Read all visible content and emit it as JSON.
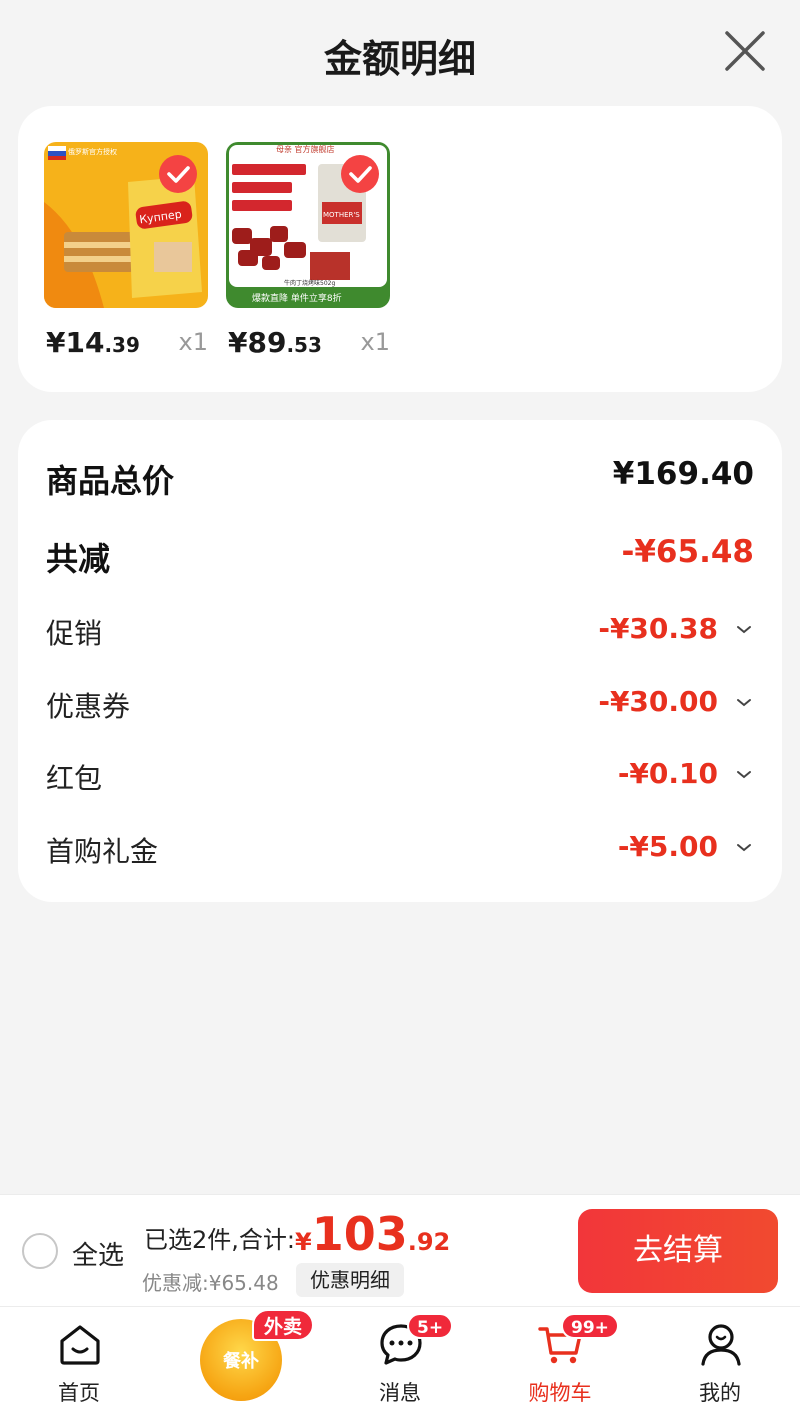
{
  "header": {
    "title": "金额明细",
    "close_icon": "close-icon"
  },
  "products": [
    {
      "price_int": "¥14",
      "price_dec": ".39",
      "qty": "x1",
      "thumb_text": "Куппер",
      "flag_text": "俄罗斯官方授权"
    },
    {
      "price_int": "¥89",
      "price_dec": ".53",
      "qty": "x1",
      "thumb_text": "MOTHER'S",
      "store_text": "母亲 官方旗舰店",
      "bullets": [
        "颗颗真牛肉 肉质紧实",
        "轻烘慢烤 非油炸",
        "软硬适中 老少皆宜"
      ],
      "size_text": "牛肉丁烧烤味502g",
      "banner_text": "爆款直降 单件立享8折"
    }
  ],
  "summary": {
    "total_label": "商品总价",
    "total_value": "¥169.40",
    "reduce_label": "共减",
    "reduce_value": "-¥65.48",
    "items": [
      {
        "label": "促销",
        "value": "-¥30.38"
      },
      {
        "label": "优惠券",
        "value": "-¥30.00"
      },
      {
        "label": "红包",
        "value": "-¥0.10"
      },
      {
        "label": "首购礼金",
        "value": "-¥5.00"
      }
    ]
  },
  "bottom": {
    "select_all": "全选",
    "selected_text": "已选2件,合计:",
    "currency": "¥",
    "amount_int": "103",
    "amount_frac": ".92",
    "discount_text": "优惠减:¥65.48",
    "detail_button": "优惠明细",
    "checkout_button": "去结算"
  },
  "tabbar": {
    "items": [
      {
        "label": "首页",
        "icon": "home-icon"
      },
      {
        "label": "餐补",
        "icon": "meal-subsidy-icon",
        "badge": "外卖"
      },
      {
        "label": "消息",
        "icon": "message-icon",
        "badge": "5+"
      },
      {
        "label": "购物车",
        "icon": "cart-icon",
        "badge": "99+"
      },
      {
        "label": "我的",
        "icon": "user-icon"
      }
    ]
  },
  "colors": {
    "accent": "#e8301e",
    "badge": "#f0293a",
    "check": "#f44343"
  }
}
